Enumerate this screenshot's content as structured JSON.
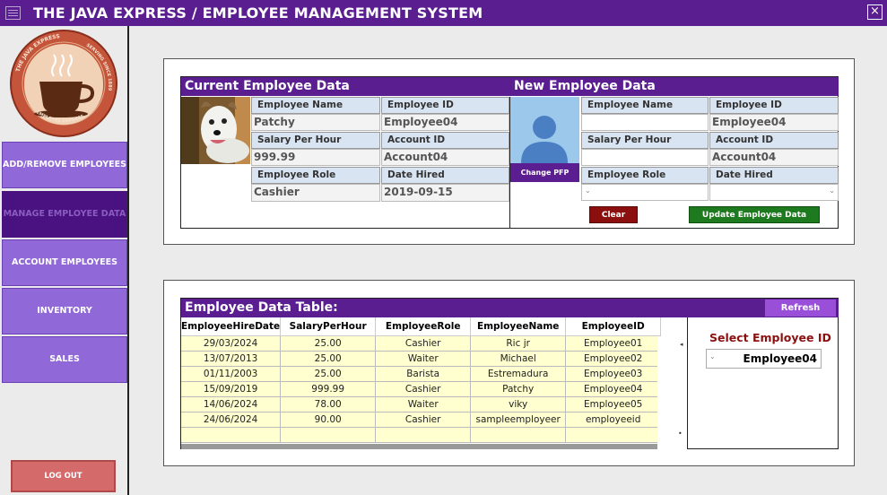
{
  "window": {
    "title": "THE JAVA EXPRESS  /  EMPLOYEE MANAGEMENT SYSTEM",
    "close_glyph": "×"
  },
  "sidebar": {
    "logo_text_top": "THE JAVA EXPRESS",
    "logo_text_bottom": "EMPLOYEE EXPRESS",
    "logo_text_side": "SERVING SINCE 1889",
    "items": [
      {
        "label": "ADD/REMOVE EMPLOYEES"
      },
      {
        "label": "MANAGE EMPLOYEE DATA"
      },
      {
        "label": "ACCOUNT EMPLOYEES"
      },
      {
        "label": "INVENTORY"
      },
      {
        "label": "SALES"
      }
    ],
    "logout": "LOG OUT"
  },
  "current": {
    "heading": "Current Employee Data",
    "name_label": "Employee Name",
    "name": "Patchy",
    "id_label": "Employee ID",
    "id": "Employee04",
    "salary_label": "Salary Per Hour",
    "salary": "999.99",
    "account_label": "Account ID",
    "account": "Account04",
    "role_label": "Employee Role",
    "role": "Cashier",
    "date_label": "Date Hired",
    "date": "2019-09-15"
  },
  "new": {
    "heading": "New Employee Data",
    "name_label": "Employee Name",
    "name": "",
    "id_label": "Employee ID",
    "id": "Employee04",
    "salary_label": "Salary Per Hour",
    "salary": "",
    "account_label": "Account ID",
    "account": "Account04",
    "role_label": "Employee Role",
    "date_label": "Date Hired",
    "change_pfp": "Change PFP",
    "clear": "Clear",
    "update": "Update Employee Data"
  },
  "table": {
    "heading": "Employee Data Table:",
    "refresh": "Refresh",
    "columns": [
      "EmployeeHireDate",
      "SalaryPerHour",
      "EmployeeRole",
      "EmployeeName",
      "EmployeeID"
    ],
    "rows": [
      [
        "29/03/2024",
        "25.00",
        "Cashier",
        "Ric jr",
        "Employee01"
      ],
      [
        "13/07/2013",
        "25.00",
        "Waiter",
        "Michael",
        "Employee02"
      ],
      [
        "01/11/2003",
        "25.00",
        "Barista",
        "Estremadura",
        "Employee03"
      ],
      [
        "15/09/2019",
        "999.99",
        "Cashier",
        "Patchy",
        "Employee04"
      ],
      [
        "14/06/2024",
        "78.00",
        "Waiter",
        "viky",
        "Employee05"
      ],
      [
        "24/06/2024",
        "90.00",
        "Cashier",
        "sampleemployeer",
        "employeeid"
      ]
    ],
    "select_label": "Select Employee ID",
    "select_value": "Employee04"
  },
  "colors": {
    "brand": "#5b1e91",
    "nav": "#9068d8",
    "nav_active": "#4a1280",
    "clear": "#8b0f0f",
    "update": "#1e7a1e",
    "logout": "#d46a6a"
  }
}
